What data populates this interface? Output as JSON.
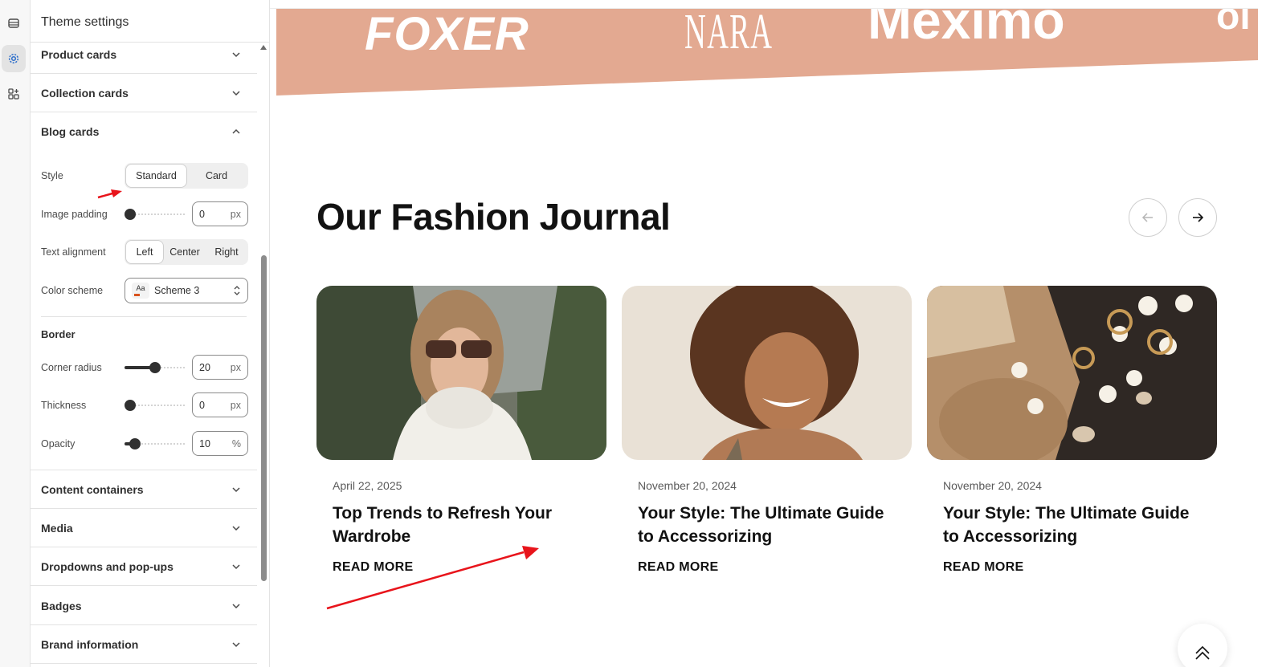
{
  "panel": {
    "title": "Theme settings",
    "sections_top": [
      {
        "label": "Product cards"
      },
      {
        "label": "Collection cards"
      },
      {
        "label": "Blog cards"
      }
    ],
    "blog_cards": {
      "style_label": "Style",
      "style_options": [
        "Standard",
        "Card"
      ],
      "style_selected": "Standard",
      "image_padding_label": "Image padding",
      "image_padding_value": "0",
      "image_padding_unit": "px",
      "text_alignment_label": "Text alignment",
      "text_alignment_options": [
        "Left",
        "Center",
        "Right"
      ],
      "text_alignment_selected": "Left",
      "color_scheme_label": "Color scheme",
      "color_scheme_swatch": "Aa",
      "color_scheme_value": "Scheme 3",
      "border_heading": "Border",
      "corner_radius_label": "Corner radius",
      "corner_radius_value": "20",
      "corner_radius_unit": "px",
      "thickness_label": "Thickness",
      "thickness_value": "0",
      "thickness_unit": "px",
      "opacity_label": "Opacity",
      "opacity_value": "10",
      "opacity_unit": "%"
    },
    "sections_bottom": [
      {
        "label": "Content containers"
      },
      {
        "label": "Media"
      },
      {
        "label": "Dropdowns and pop-ups"
      },
      {
        "label": "Badges"
      },
      {
        "label": "Brand information"
      }
    ]
  },
  "preview": {
    "brand_band_color": "#e3a991",
    "brands": [
      "FOXER",
      "NARA",
      "Meximo"
    ],
    "journal_title": "Our Fashion Journal",
    "cards": [
      {
        "date": "April 22, 2025",
        "title": "Top Trends to Refresh Your Wardrobe",
        "cta": "READ MORE"
      },
      {
        "date": "November 20, 2024",
        "title": "Your Style: The Ultimate Guide to Accessorizing",
        "cta": "READ MORE"
      },
      {
        "date": "November 20, 2024",
        "title": "Your Style: The Ultimate Guide to Accessorizing",
        "cta": "READ MORE"
      }
    ]
  },
  "annotation_color": "#e8141b"
}
